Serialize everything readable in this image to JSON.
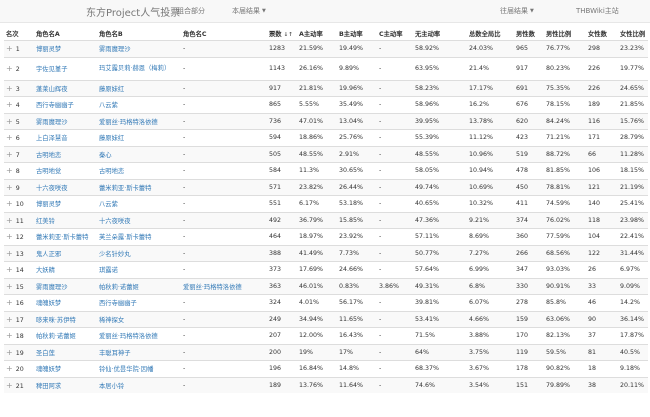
{
  "nav": {
    "brand": "东方Project人气投票",
    "link1": "组合部分",
    "link2": "本届结果",
    "link3": "往届结果",
    "link4": "THBWiki主站"
  },
  "columns": [
    "名次",
    "角色名A",
    "角色名B",
    "角色名C",
    "票数",
    "A主动率",
    "B主动率",
    "C主动率",
    "无主动率",
    "总数全局比",
    "男性数",
    "男性比例",
    "女性数",
    "女性比例"
  ],
  "rows": [
    [
      "1",
      "博丽灵梦",
      "雾雨魔理沙",
      "-",
      "1283",
      "21.59%",
      "19.49%",
      "-",
      "58.92%",
      "24.03%",
      "965",
      "76.77%",
      "298",
      "23.23%"
    ],
    [
      "2",
      "宇佐见堇子",
      "玛艾露贝莉·赫恩（梅莉）",
      "-",
      "1143",
      "26.16%",
      "9.89%",
      "-",
      "63.95%",
      "21.4%",
      "917",
      "80.23%",
      "226",
      "19.77%"
    ],
    [
      "3",
      "蓬莱山辉夜",
      "藤原妹红",
      "-",
      "917",
      "21.81%",
      "19.96%",
      "-",
      "58.23%",
      "17.17%",
      "691",
      "75.35%",
      "226",
      "24.65%"
    ],
    [
      "4",
      "西行寺幽幽子",
      "八云紫",
      "-",
      "865",
      "5.55%",
      "35.49%",
      "-",
      "58.96%",
      "16.2%",
      "676",
      "78.15%",
      "189",
      "21.85%"
    ],
    [
      "5",
      "雾雨魔理沙",
      "爱丽丝·玛格特洛依德",
      "-",
      "736",
      "47.01%",
      "13.04%",
      "-",
      "39.95%",
      "13.78%",
      "620",
      "84.24%",
      "116",
      "15.76%"
    ],
    [
      "6",
      "上白泽慧音",
      "藤原妹红",
      "-",
      "594",
      "18.86%",
      "25.76%",
      "-",
      "55.39%",
      "11.12%",
      "423",
      "71.21%",
      "171",
      "28.79%"
    ],
    [
      "7",
      "古明地恋",
      "秦心",
      "-",
      "505",
      "48.55%",
      "2.91%",
      "-",
      "48.55%",
      "10.96%",
      "519",
      "88.72%",
      "66",
      "11.28%"
    ],
    [
      "8",
      "古明地觉",
      "古明地恋",
      "-",
      "584",
      "11.3%",
      "30.65%",
      "-",
      "58.05%",
      "10.94%",
      "478",
      "81.85%",
      "106",
      "18.15%"
    ],
    [
      "9",
      "十六夜咲夜",
      "蕾米莉亚·斯卡蕾特",
      "-",
      "571",
      "23.82%",
      "26.44%",
      "-",
      "49.74%",
      "10.69%",
      "450",
      "78.81%",
      "121",
      "21.19%"
    ],
    [
      "10",
      "博丽灵梦",
      "八云紫",
      "-",
      "551",
      "6.17%",
      "53.18%",
      "-",
      "40.65%",
      "10.32%",
      "411",
      "74.59%",
      "140",
      "25.41%"
    ],
    [
      "11",
      "红美铃",
      "十六夜咲夜",
      "-",
      "492",
      "36.79%",
      "15.85%",
      "-",
      "47.36%",
      "9.21%",
      "374",
      "76.02%",
      "118",
      "23.98%"
    ],
    [
      "12",
      "蕾米莉亚·斯卡蕾特",
      "芙兰朵露·斯卡蕾特",
      "-",
      "464",
      "18.97%",
      "23.92%",
      "-",
      "57.11%",
      "8.69%",
      "360",
      "77.59%",
      "104",
      "22.41%"
    ],
    [
      "13",
      "鬼人正邪",
      "少名针妙丸",
      "-",
      "388",
      "41.49%",
      "7.73%",
      "-",
      "50.77%",
      "7.27%",
      "266",
      "68.56%",
      "122",
      "31.44%"
    ],
    [
      "14",
      "大妖精",
      "琪露诺",
      "-",
      "373",
      "17.69%",
      "24.66%",
      "-",
      "57.64%",
      "6.99%",
      "347",
      "93.03%",
      "26",
      "6.97%"
    ],
    [
      "15",
      "雾雨魔理沙",
      "帕秋莉·诺蕾姬",
      "爱丽丝·玛格特洛依德",
      "363",
      "46.01%",
      "0.83%",
      "3.86%",
      "49.31%",
      "6.8%",
      "330",
      "90.91%",
      "33",
      "9.09%"
    ],
    [
      "16",
      "魂魄妖梦",
      "西行寺幽幽子",
      "-",
      "324",
      "4.01%",
      "56.17%",
      "-",
      "39.81%",
      "6.07%",
      "278",
      "85.8%",
      "46",
      "14.2%"
    ],
    [
      "17",
      "哆来咪·苏伊特",
      "稀神探女",
      "-",
      "249",
      "34.94%",
      "11.65%",
      "-",
      "53.41%",
      "4.66%",
      "159",
      "63.06%",
      "90",
      "36.14%"
    ],
    [
      "18",
      "帕秋莉·诺蕾姬",
      "爱丽丝·玛格特洛依德",
      "-",
      "207",
      "12.00%",
      "16.43%",
      "-",
      "71.5%",
      "3.88%",
      "170",
      "82.13%",
      "37",
      "17.87%"
    ],
    [
      "19",
      "圣白莲",
      "丰聪耳神子",
      "-",
      "200",
      "19%",
      "17%",
      "-",
      "64%",
      "3.75%",
      "119",
      "59.5%",
      "81",
      "40.5%"
    ],
    [
      "20",
      "魂魄妖梦",
      "铃仙·优昙华院·因幡",
      "-",
      "196",
      "16.84%",
      "14.8%",
      "-",
      "68.37%",
      "3.67%",
      "178",
      "90.82%",
      "18",
      "9.18%"
    ],
    [
      "21",
      "稗田阿求",
      "本居小铃",
      "-",
      "189",
      "13.76%",
      "11.64%",
      "-",
      "74.6%",
      "3.54%",
      "151",
      "79.89%",
      "38",
      "20.11%"
    ]
  ]
}
